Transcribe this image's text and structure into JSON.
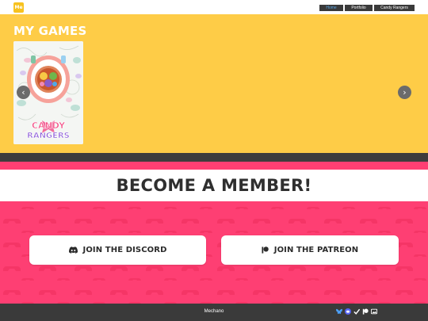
{
  "header": {
    "logo_text": "Me",
    "nav": [
      {
        "label": "Home",
        "active": true
      },
      {
        "label": "Portfolio",
        "active": false
      },
      {
        "label": "Candy Rangers",
        "active": false
      }
    ]
  },
  "games": {
    "title": "MY GAMES",
    "cover_logo_line1": "CANDY",
    "cover_logo_line2": "RANGERS",
    "prev_icon": "chevron-left-icon",
    "next_icon": "chevron-right-icon"
  },
  "member": {
    "title": "BECOME A MEMBER!",
    "discord_label": "JOIN THE DISCORD",
    "patreon_label": "JOIN THE PATREON"
  },
  "footer": {
    "text": "Mechano",
    "social_icons": [
      "bluesky-icon",
      "discord-icon",
      "check-icon",
      "patreon-icon",
      "gallery-icon"
    ]
  },
  "colors": {
    "games_bg": "#fecc47",
    "member_bg": "#fe3f73",
    "dark": "#3a3a3a",
    "accent_blue": "#5aa7e6"
  }
}
